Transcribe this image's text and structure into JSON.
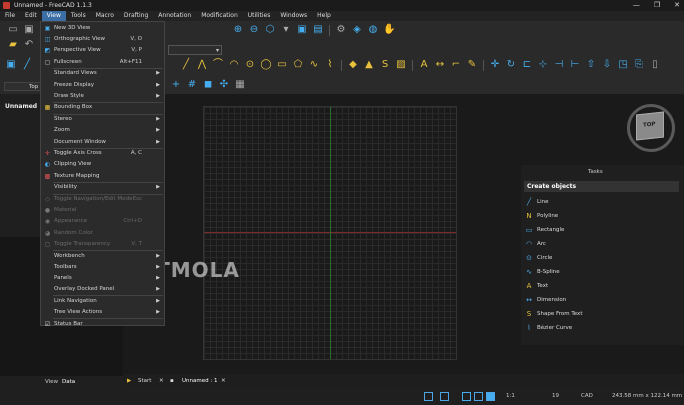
{
  "window": {
    "title": "Unnamed - FreeCAD 1.1.3",
    "controls": [
      "—",
      "❐",
      "✕"
    ]
  },
  "menubar": [
    "File",
    "Edit",
    "View",
    "Tools",
    "Macro",
    "Drafting",
    "Annotation",
    "Modification",
    "Utilities",
    "Windows",
    "Help"
  ],
  "active_menu": "View",
  "view_selector": {
    "label": "Top"
  },
  "tree": {
    "document": "Unnamed"
  },
  "view_menu": [
    {
      "label": "New 3D View",
      "shortcut": "",
      "submenu": false,
      "disabled": false,
      "icon": "new-3d-view-icon"
    },
    {
      "label": "Orthographic View",
      "shortcut": "V, O",
      "submenu": false,
      "disabled": false,
      "icon": "orthographic-icon"
    },
    {
      "label": "Perspective View",
      "shortcut": "V, P",
      "submenu": false,
      "disabled": false,
      "icon": "perspective-icon"
    },
    {
      "label": "Fullscreen",
      "shortcut": "Alt+F11",
      "submenu": false,
      "disabled": false,
      "icon": "fullscreen-icon"
    },
    {
      "label": "Standard Views",
      "shortcut": "",
      "submenu": true,
      "disabled": false,
      "icon": ""
    },
    {
      "label": "Freeze Display",
      "shortcut": "",
      "submenu": true,
      "disabled": false,
      "icon": ""
    },
    {
      "label": "Draw Style",
      "shortcut": "",
      "submenu": true,
      "disabled": false,
      "icon": ""
    },
    {
      "label": "Bounding Box",
      "shortcut": "",
      "submenu": false,
      "disabled": false,
      "icon": "bounding-box-icon"
    },
    {
      "label": "Stereo",
      "shortcut": "",
      "submenu": true,
      "disabled": false,
      "icon": ""
    },
    {
      "label": "Zoom",
      "shortcut": "",
      "submenu": true,
      "disabled": false,
      "icon": ""
    },
    {
      "label": "Document Window",
      "shortcut": "",
      "submenu": true,
      "disabled": false,
      "icon": ""
    },
    {
      "label": "Toggle Axis Cross",
      "shortcut": "A, C",
      "submenu": false,
      "disabled": false,
      "icon": "axis-cross-icon"
    },
    {
      "label": "Clipping View",
      "shortcut": "",
      "submenu": false,
      "disabled": false,
      "icon": "clipping-icon"
    },
    {
      "label": "Texture Mapping",
      "shortcut": "",
      "submenu": false,
      "disabled": false,
      "icon": "texture-icon"
    },
    {
      "label": "Visibility",
      "shortcut": "",
      "submenu": true,
      "disabled": false,
      "icon": ""
    },
    {
      "label": "Toggle Navigation/Edit Mode",
      "shortcut": "Esc",
      "submenu": false,
      "disabled": true,
      "icon": "toggle-nav-icon"
    },
    {
      "label": "Material",
      "shortcut": "",
      "submenu": false,
      "disabled": true,
      "icon": "material-icon"
    },
    {
      "label": "Appearance",
      "shortcut": "Ctrl+D",
      "submenu": false,
      "disabled": true,
      "icon": "appearance-icon"
    },
    {
      "label": "Random Color",
      "shortcut": "",
      "submenu": false,
      "disabled": true,
      "icon": "random-color-icon"
    },
    {
      "label": "Toggle Transparency",
      "shortcut": "V, T",
      "submenu": false,
      "disabled": true,
      "icon": "transparency-icon"
    },
    {
      "label": "Workbench",
      "shortcut": "",
      "submenu": true,
      "disabled": false,
      "icon": ""
    },
    {
      "label": "Toolbars",
      "shortcut": "",
      "submenu": true,
      "disabled": false,
      "icon": ""
    },
    {
      "label": "Panels",
      "shortcut": "",
      "submenu": true,
      "disabled": false,
      "icon": ""
    },
    {
      "label": "Overlay Docked Panel",
      "shortcut": "",
      "submenu": true,
      "disabled": false,
      "icon": ""
    },
    {
      "label": "Link Navigation",
      "shortcut": "",
      "submenu": true,
      "disabled": false,
      "icon": ""
    },
    {
      "label": "Tree View Actions",
      "shortcut": "",
      "submenu": true,
      "disabled": false,
      "icon": ""
    },
    {
      "label": "Status Bar",
      "shortcut": "",
      "submenu": false,
      "disabled": false,
      "icon": "checkbox-checked-icon"
    }
  ],
  "navcube": {
    "face": "TOP"
  },
  "tasks": {
    "title": "Tasks",
    "header": "Create objects",
    "items": [
      "Line",
      "Polyline",
      "Rectangle",
      "Arc",
      "Circle",
      "B-Spline",
      "Text",
      "Dimension",
      "Shape From Text",
      "Bézier Curve"
    ]
  },
  "combo_tab": {
    "view": "View",
    "data": "Data"
  },
  "doc_tabs": {
    "start": "Start",
    "unnamed": "Unnamed : 1"
  },
  "status": {
    "scale": "1:1",
    "layer": "19",
    "unit": "CAD",
    "dimensions": "243.58 mm x 122.14 mm"
  },
  "watermark": "SOFTMOLA",
  "colors": {
    "accent": "#3b6ea5",
    "icon_blue": "#46aef0",
    "icon_yellow": "#e8c23d"
  }
}
